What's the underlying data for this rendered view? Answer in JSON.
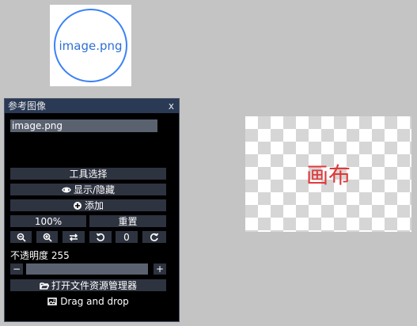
{
  "thumbnail": {
    "text": "image.png"
  },
  "panel": {
    "title": "参考图像",
    "close": "x",
    "file_name": "image.png",
    "tool_select": "工具选择",
    "show_hide": "显示/隐藏",
    "add": "添加",
    "zoom": "100%",
    "reset": "重置",
    "rotation": "0",
    "opacity_label": "不透明度 255",
    "minus": "−",
    "plus": "+",
    "open_explorer": "打开文件资源管理器",
    "drag_drop": "Drag and drop"
  },
  "canvas": {
    "label": "画布"
  },
  "colors": {
    "accent_blue": "#3b82f6",
    "canvas_label": "#e03a3a",
    "panel_title_bg": "#2a3a55"
  }
}
